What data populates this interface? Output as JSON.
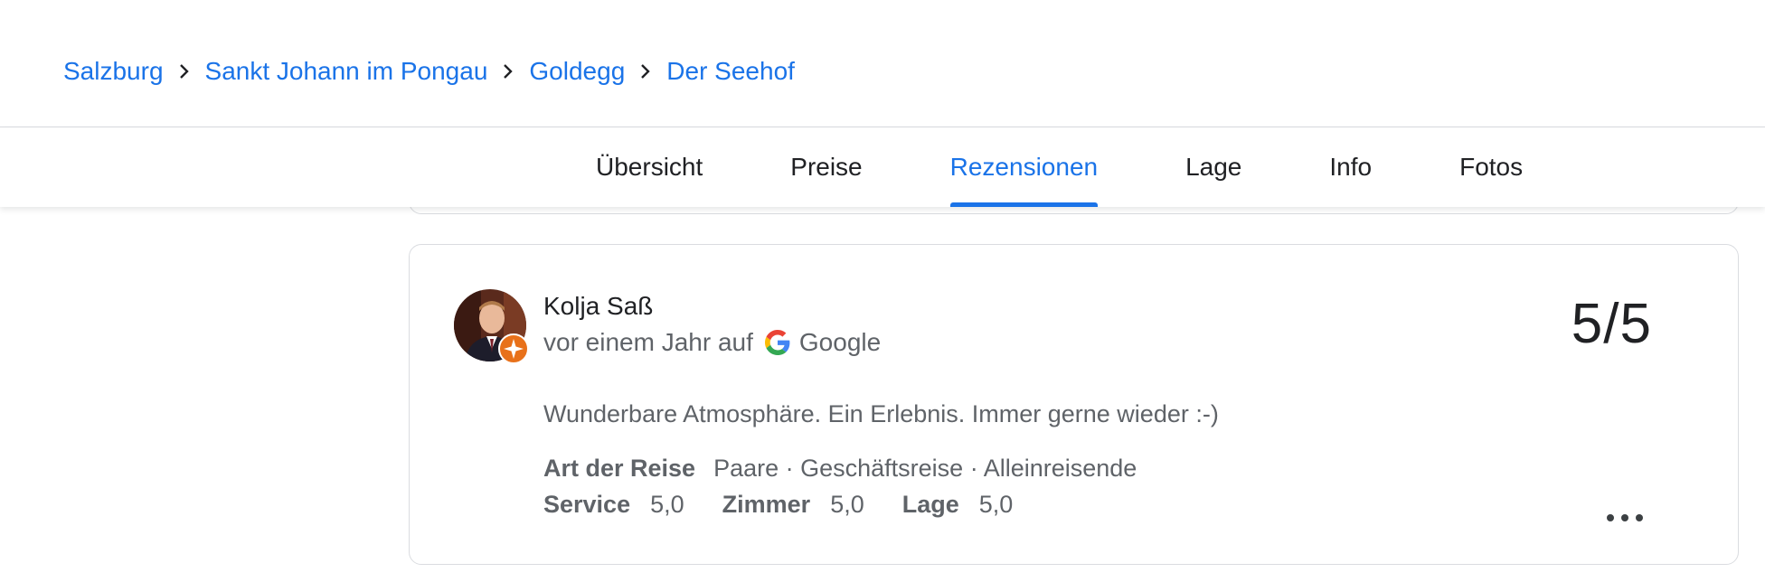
{
  "breadcrumb": [
    {
      "label": "Salzburg"
    },
    {
      "label": "Sankt Johann im Pongau"
    },
    {
      "label": "Goldegg"
    },
    {
      "label": "Der Seehof"
    }
  ],
  "tabs": [
    {
      "label": "Übersicht",
      "active": false
    },
    {
      "label": "Preise",
      "active": false
    },
    {
      "label": "Rezensionen",
      "active": true
    },
    {
      "label": "Lage",
      "active": false
    },
    {
      "label": "Info",
      "active": false
    },
    {
      "label": "Fotos",
      "active": false
    }
  ],
  "review": {
    "reviewer_name": "Kolja Saß",
    "time": "vor einem Jahr auf",
    "source": "Google",
    "score": "5/5",
    "text": "Wunderbare Atmosphäre. Ein Erlebnis. Immer gerne wieder :-)",
    "trip_label": "Art der Reise",
    "trip_value": "Paare · Geschäftsreise · Alleinreisende",
    "ratings": [
      {
        "label": "Service",
        "value": "5,0"
      },
      {
        "label": "Zimmer",
        "value": "5,0"
      },
      {
        "label": "Lage",
        "value": "5,0"
      }
    ]
  },
  "colors": {
    "accent": "#1a73e8",
    "badge": "#e8711a"
  }
}
